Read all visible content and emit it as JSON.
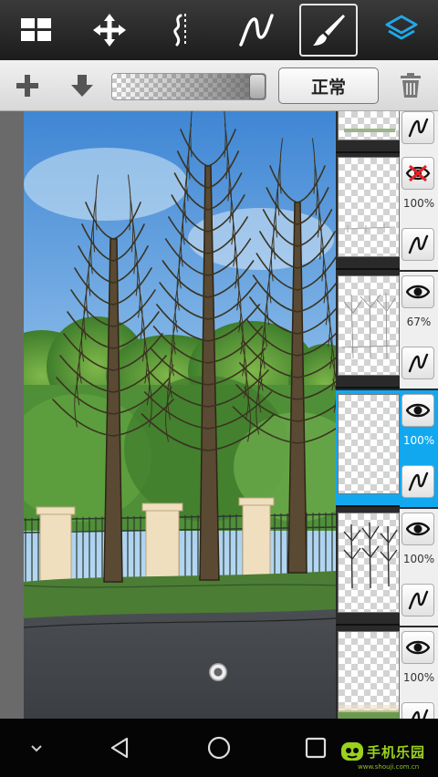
{
  "toolbar": {
    "tools": [
      {
        "name": "grid-menu",
        "icon": "grid-icon",
        "active": false
      },
      {
        "name": "transform",
        "icon": "move-icon",
        "active": false
      },
      {
        "name": "symmetry",
        "icon": "symmetry-icon",
        "active": false
      },
      {
        "name": "stroke",
        "icon": "stroke-icon",
        "active": false
      },
      {
        "name": "brush",
        "icon": "brush-icon",
        "active": true
      },
      {
        "name": "layers",
        "icon": "layers-icon",
        "active": false
      }
    ],
    "accent": "#12a8ef"
  },
  "layer_bar": {
    "add_icon": "plus-icon",
    "merge_icon": "merge-down-icon",
    "opacity_slider_level": 1.0,
    "blend_mode_label": "正常",
    "delete_icon": "trash-icon"
  },
  "layers": [
    {
      "visibility_icon": "visibility-hidden-icon",
      "opacity": "",
      "blend_icon": "stroke-icon",
      "selected": false,
      "partial": true
    },
    {
      "visibility_icon": "visibility-hidden-icon",
      "opacity": "100%",
      "blend_icon": "stroke-icon",
      "selected": false
    },
    {
      "visibility_icon": "eye-icon",
      "opacity": "67%",
      "blend_icon": "stroke-icon",
      "selected": false
    },
    {
      "visibility_icon": "eye-icon",
      "opacity": "100%",
      "blend_icon": "stroke-icon",
      "selected": true
    },
    {
      "visibility_icon": "eye-icon",
      "opacity": "100%",
      "blend_icon": "stroke-icon",
      "selected": false
    },
    {
      "visibility_icon": "eye-icon",
      "opacity": "100%",
      "blend_icon": "stroke-icon",
      "selected": false
    }
  ],
  "navigation": {
    "buttons": [
      "chevron-down-icon",
      "back-icon",
      "home-icon",
      "recents-icon"
    ]
  },
  "watermark": {
    "text": "手机乐园",
    "subtext": "www.shouji.com.cn",
    "color": "#9ad21c"
  }
}
